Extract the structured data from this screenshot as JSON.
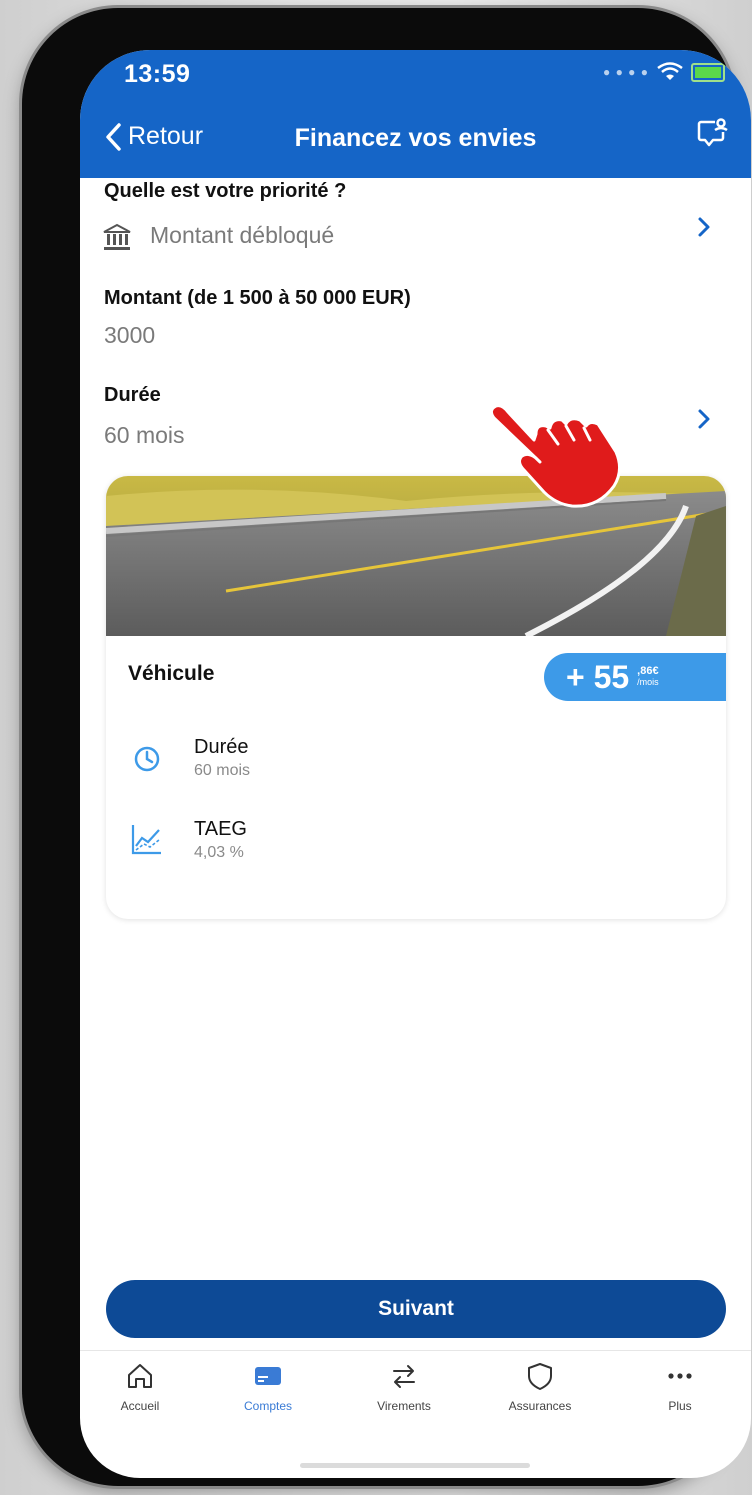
{
  "status_bar": {
    "time": "13:59"
  },
  "nav": {
    "back_label": "Retour",
    "title": "Financez vos envies"
  },
  "priority": {
    "label": "Quelle est votre priorité ?",
    "value": "Montant débloqué"
  },
  "amount": {
    "label": "Montant (de 1 500 à 50 000 EUR)",
    "value": "3000"
  },
  "duration": {
    "label": "Durée",
    "value": "60 mois"
  },
  "offer_card": {
    "title": "Véhicule",
    "price_prefix": "+ 55",
    "price_cents": ",86€",
    "price_unit": "/mois",
    "details": [
      {
        "icon": "clock-icon",
        "label": "Durée",
        "value": "60 mois"
      },
      {
        "icon": "chart-icon",
        "label": "TAEG",
        "value": "4,03 %"
      }
    ]
  },
  "cta": {
    "label": "Suivant"
  },
  "tabbar": {
    "items": [
      {
        "label": "Accueil",
        "icon": "home-icon",
        "active": false
      },
      {
        "label": "Comptes",
        "icon": "card-icon",
        "active": true
      },
      {
        "label": "Virements",
        "icon": "transfer-icon",
        "active": false
      },
      {
        "label": "Assurances",
        "icon": "shield-icon",
        "active": false
      },
      {
        "label": "Plus",
        "icon": "more-icon",
        "active": false
      }
    ]
  },
  "colors": {
    "brand_blue": "#1565c7",
    "button_blue": "#0d4a96",
    "badge_blue": "#3d9ae8",
    "pointer_red": "#e01b1b"
  }
}
